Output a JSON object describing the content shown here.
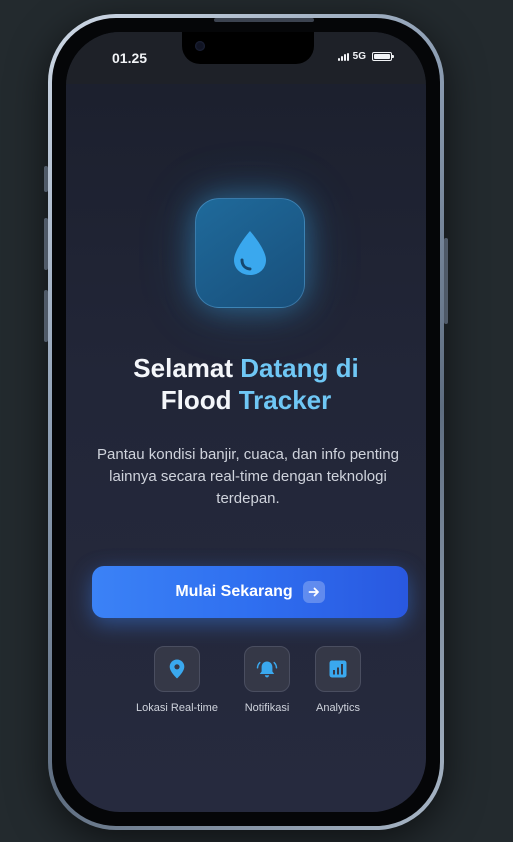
{
  "status_bar": {
    "time": "01.25",
    "network": "5G"
  },
  "hero": {
    "icon": "water-drop-icon",
    "title_line1_plain": "Selamat ",
    "title_line1_accent": "Datang di",
    "title_line2_plain": "Flood ",
    "title_line2_accent": "Tracker",
    "description": "Pantau kondisi banjir, cuaca, dan info penting lainnya secara real-time dengan teknologi terdepan."
  },
  "cta": {
    "label": "Mulai Sekarang",
    "icon": "arrow-right-icon"
  },
  "features": [
    {
      "label": "Lokasi Real-time",
      "icon": "map-pin-icon"
    },
    {
      "label": "Notifikasi",
      "icon": "bell-alert-icon"
    },
    {
      "label": "Analytics",
      "icon": "bar-chart-icon"
    }
  ],
  "colors": {
    "accent": "#6fc7f5",
    "button": "#3b82f6",
    "icon_blue": "#3aa8ee",
    "background": "#232a2e"
  }
}
